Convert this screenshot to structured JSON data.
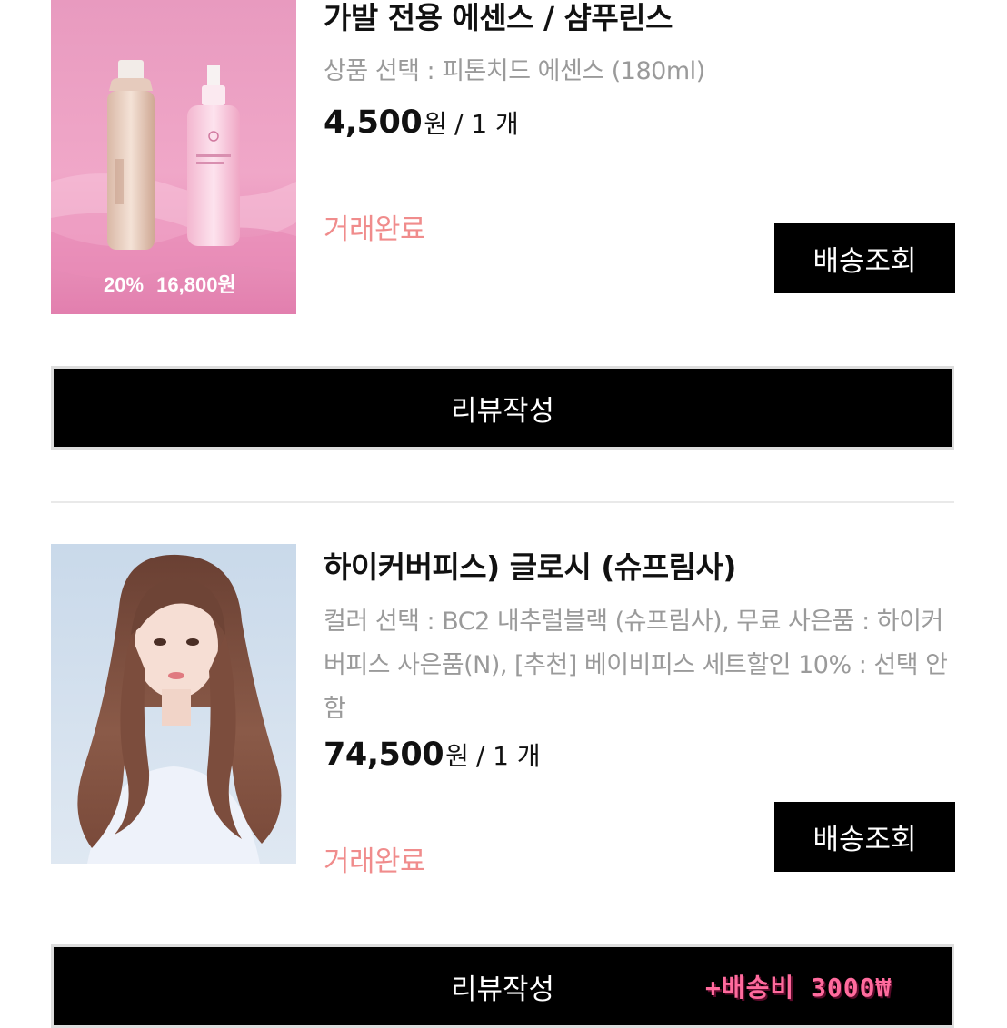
{
  "orders": [
    {
      "title": "가발 전용 에센스 / 샴푸린스",
      "option": "상품 선택 : 피톤치드 에센스 (180ml)",
      "price": "4,500",
      "currency": "원",
      "quantity": "/ 1 개",
      "status": "거래완료",
      "track_label": "배송조회",
      "review_label": "리뷰작성",
      "image": {
        "discount_text": "20%",
        "price_text": "16,800원",
        "description": "pink background with two hair essence bottles"
      }
    },
    {
      "title": "하이커버피스) 글로시 (슈프림사)",
      "option": "컬러 선택 : BC2 내추럴블랙 (슈프림사), 무료 사은품 : 하이커버피스 사은품(N), [추천] 베이비피스 세트할인 10% : 선택 안함",
      "price": "74,500",
      "currency": "원",
      "quantity": "/ 1 개",
      "status": "거래완료",
      "track_label": "배송조회",
      "review_label": "리뷰작성",
      "image": {
        "description": "model with long wavy brown hair"
      }
    }
  ],
  "shipping_badge": "+배송비 3000₩",
  "colors": {
    "status": "#f08c8c",
    "button_bg": "#000000",
    "option_text": "#9a9a9a",
    "badge": "#ff6b9d"
  }
}
